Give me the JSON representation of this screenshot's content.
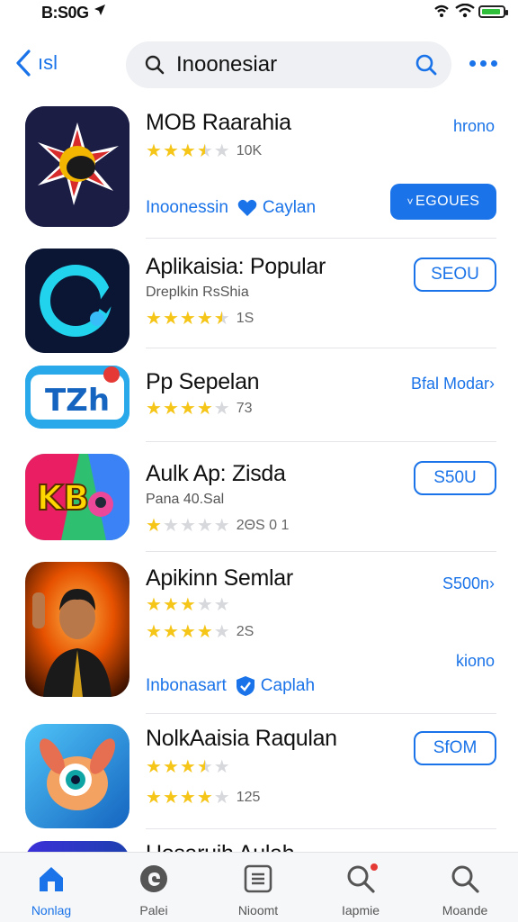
{
  "status_bar": {
    "time": "B:S0G",
    "location_icon": "location-arrow-icon"
  },
  "nav": {
    "back_label": "ısl",
    "search_value": "Inoonesiar",
    "colors": {
      "accent": "#1a73e8"
    }
  },
  "apps": [
    {
      "title": "MOB Raarahia",
      "rating": 3.5,
      "rating_count": "10K",
      "right_link": "hrono",
      "meta_left": "Inoonessin",
      "meta_category": "Caylan",
      "button": "EGOUES"
    },
    {
      "title": "Aplikaisia: Popular",
      "subtitle": "Dreplkin RsShia",
      "rating": 4.5,
      "rating_count": "1S",
      "button": "SEOU"
    },
    {
      "title": "Pp Sepelan",
      "rating": 4,
      "rating_count": "73",
      "right_link": "Bfal Modar"
    },
    {
      "title": "Aulk Ap: Zisda",
      "subtitle": "Pana 40.Sal",
      "rating": 1,
      "rating_count": "2ΘS 0 1",
      "button": "S50U"
    },
    {
      "title": "Apikinn Semlar",
      "rating": 3,
      "rating2": 4,
      "rating_count": "2S",
      "right_link": "S500n",
      "right_link2": "kiono",
      "meta_left": "Inbonasart",
      "meta_category": "Caplah"
    },
    {
      "title": "NolkAaisia Raqulan",
      "rating": 3.5,
      "rating2": 4,
      "rating_count": "125",
      "button": "SfOM"
    },
    {
      "title": "Uosaruih Aulah"
    }
  ],
  "tabs": [
    {
      "label": "Nonlag",
      "icon": "home-icon",
      "active": true
    },
    {
      "label": "Palei",
      "icon": "games-icon",
      "active": false
    },
    {
      "label": "Nioomt",
      "icon": "apps-icon",
      "active": false
    },
    {
      "label": "Iapmie",
      "icon": "updates-search-icon",
      "active": false,
      "badge": true
    },
    {
      "label": "Moande",
      "icon": "search-icon",
      "active": false
    }
  ]
}
